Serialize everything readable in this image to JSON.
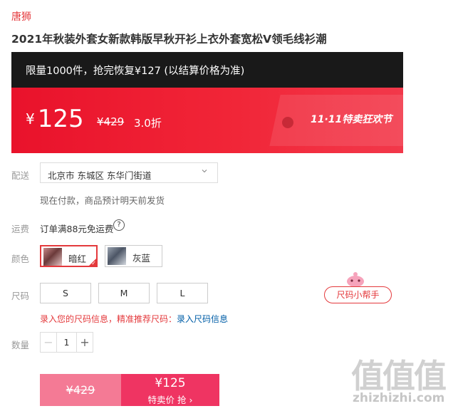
{
  "brand": "唐狮",
  "product_title": "2021年秋装外套女新款韩版早秋开衫上衣外套宽松V领毛线衫潮",
  "promo": {
    "limit_text": "限量1000件，抢完恢复¥127 (以结算价格为准)",
    "currency": "¥",
    "price": "125",
    "original_price": "¥429",
    "discount": "3.0折",
    "event_tag": "11·11特卖狂欢节"
  },
  "delivery": {
    "label": "配送",
    "address": "北京市 东城区 东华门街道",
    "note": "现在付款，商品预计明天前发货"
  },
  "shipping": {
    "label": "运费",
    "text": "订单满88元免运费",
    "help_glyph": "?"
  },
  "color": {
    "label": "颜色",
    "options": [
      {
        "name": "暗红",
        "selected": true
      },
      {
        "name": "灰蓝",
        "selected": false
      }
    ]
  },
  "size": {
    "label": "尺码",
    "options": [
      "S",
      "M",
      "L"
    ],
    "helper": "尺码小帮手",
    "hint_prefix": "录入您的尺码信息，精准推荐尺码：",
    "hint_link": "录入尺码信息"
  },
  "quantity": {
    "label": "数量",
    "value": "1",
    "minus": "−",
    "plus": "+"
  },
  "buy": {
    "original_price": "¥429",
    "price": "¥125",
    "action": "特卖价 抢 ›"
  },
  "watermark": {
    "big": "值值值",
    "small": "zhizhizhi.com"
  },
  "colors": {
    "accent": "#e4393c",
    "buy_left": "#f47a95",
    "buy_right": "#ef3462",
    "promo_dark": "#191919"
  }
}
